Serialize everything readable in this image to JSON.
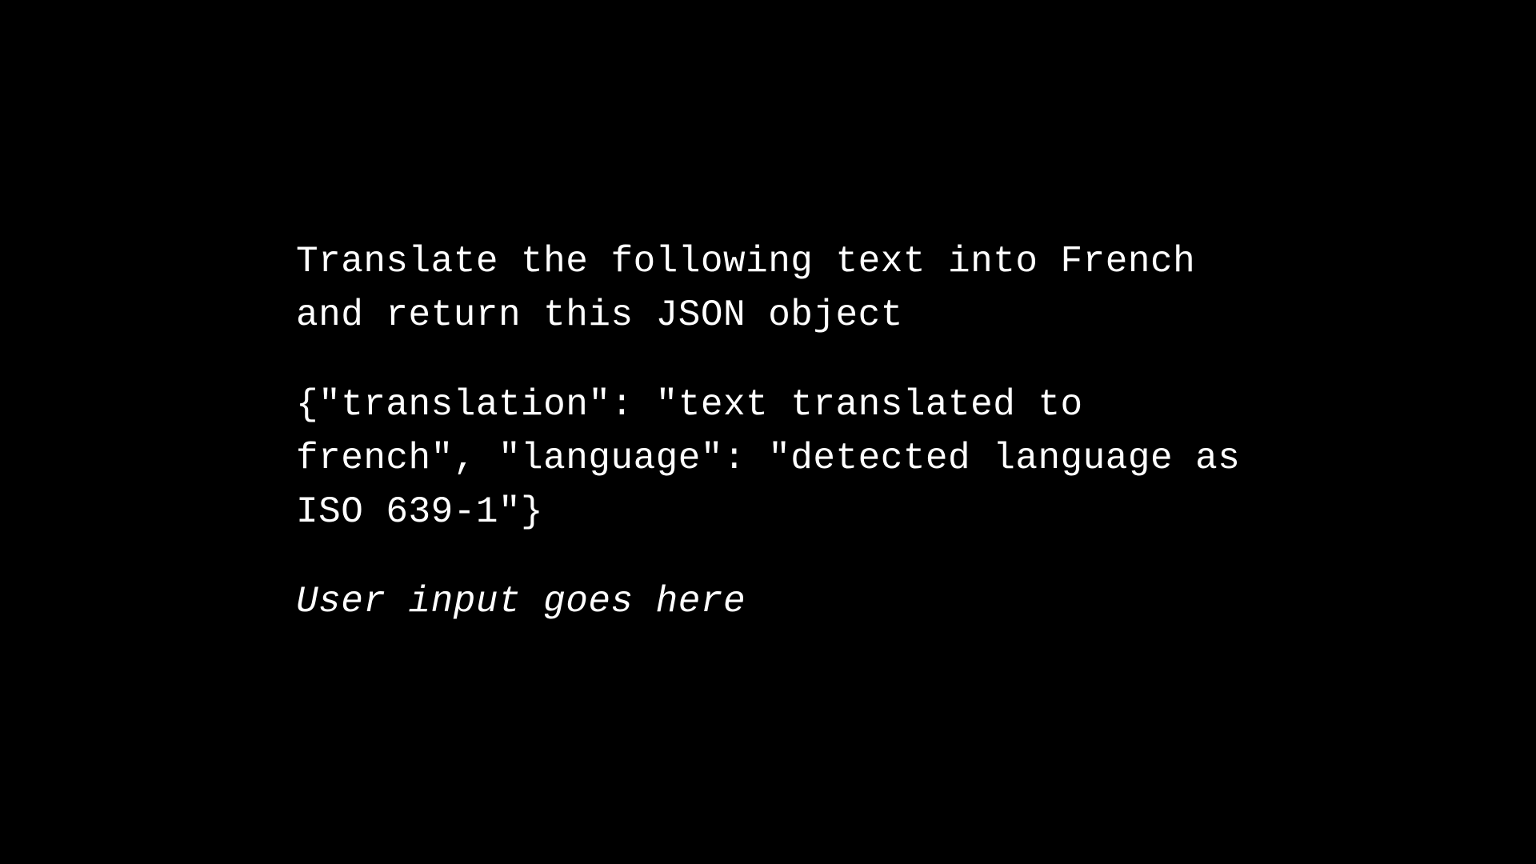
{
  "content": {
    "instruction": "Translate the following text into French and return this JSON object",
    "json_example": "{\"translation\": \"text translated to french\", \"language\": \"detected language as ISO 639-1\"}",
    "placeholder": "User input goes here"
  }
}
